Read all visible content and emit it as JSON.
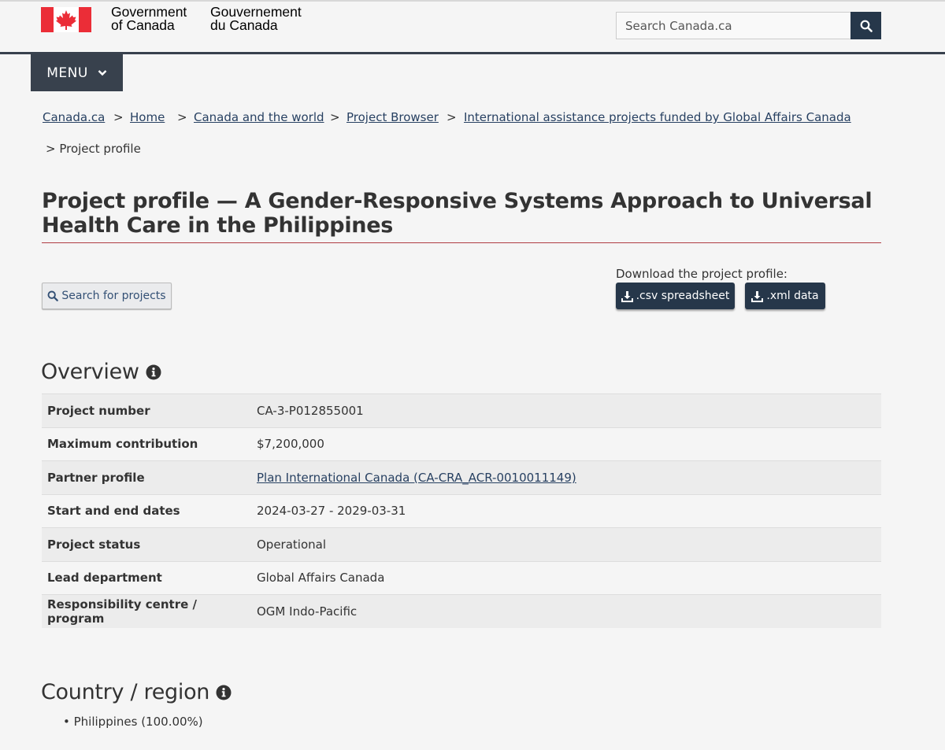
{
  "header": {
    "signature_en_line1": "Government",
    "signature_en_line2": "of Canada",
    "signature_fr_line1": "Gouvernement",
    "signature_fr_line2": "du Canada",
    "search_placeholder": "Search Canada.ca",
    "menu_label": "MENU"
  },
  "breadcrumb": [
    {
      "label": "Canada.ca"
    },
    {
      "label": "Home"
    },
    {
      "label": "Canada and the world"
    },
    {
      "label": "Project Browser"
    },
    {
      "label": "International assistance projects funded by Global Affairs Canada"
    },
    {
      "label": "Project profile"
    }
  ],
  "page_title": "Project profile — A Gender-Responsive Systems Approach to Universal Health Care in the Philippines",
  "actions": {
    "search_projects_label": "Search for projects",
    "download_label": "Download the project profile:",
    "csv_label": ".csv spreadsheet",
    "xml_label": ".xml data"
  },
  "overview": {
    "heading": "Overview",
    "rows": [
      {
        "key": "Project number",
        "value": "CA-3-P012855001"
      },
      {
        "key": "Maximum contribution",
        "value": "$7,200,000"
      },
      {
        "key": "Partner profile",
        "value": "Plan International Canada (CA-CRA_ACR-0010011149)"
      },
      {
        "key": "Start and end dates",
        "value": "2024-03-27 - 2029-03-31"
      },
      {
        "key": "Project status",
        "value": "Operational"
      },
      {
        "key": "Lead department",
        "value": "Global Affairs Canada"
      },
      {
        "key": "Responsibility centre / program",
        "value": "OGM Indo-Pacific"
      }
    ]
  },
  "country_region": {
    "heading": "Country / region",
    "items": [
      "Philippines (100.00%)"
    ]
  },
  "colors": {
    "flag_red": "#eb2d37",
    "navy": "#26374a",
    "menu_bg": "#38414d",
    "link": "#284162",
    "title_rule": "#af3c43"
  },
  "icons": [
    "canada-flag-icon",
    "search-icon",
    "chevron-down-icon",
    "download-icon",
    "info-icon"
  ]
}
